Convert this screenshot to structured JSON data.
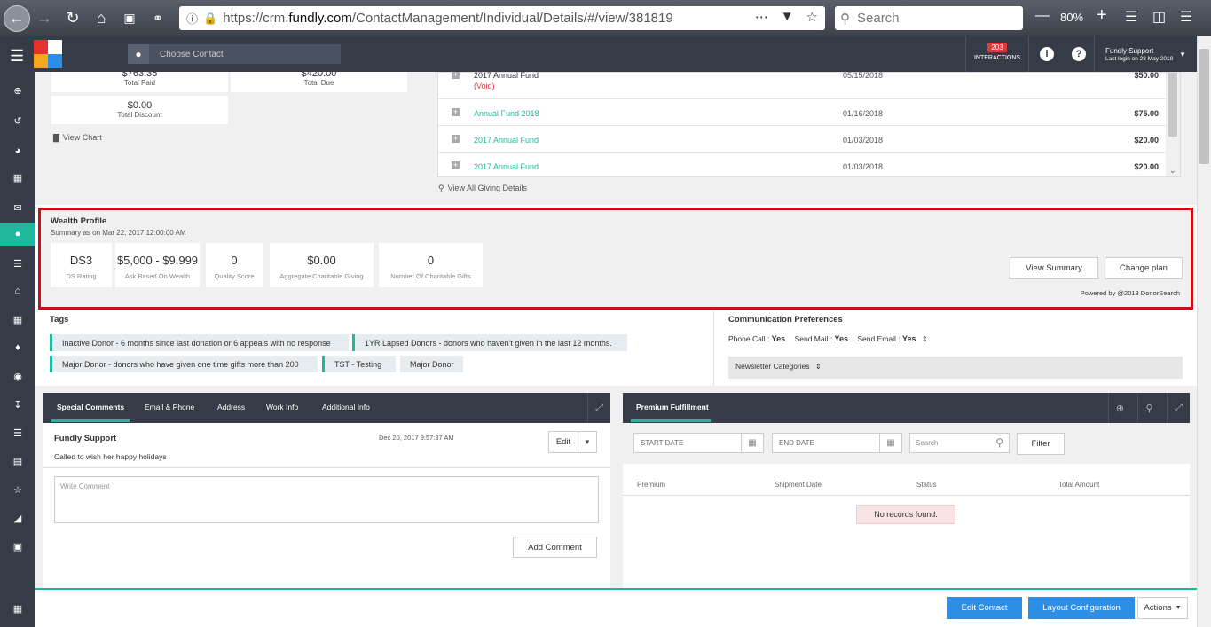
{
  "browser": {
    "url_prefix": "https://crm.",
    "url_domain": "fundly.com",
    "url_path": "/ContactManagement/Individual/Details/#/view/381819",
    "search_placeholder": "Search",
    "zoom": "80%"
  },
  "header": {
    "contact_placeholder": "Choose Contact",
    "interactions_count": "203",
    "interactions_label": "INTERACTIONS",
    "user_name": "Fundly Support",
    "last_login": "Last login on 28 May 2018"
  },
  "summary": {
    "total_paid_value": "$763.35",
    "total_paid_label": "Total Paid",
    "total_due_value": "$420.00",
    "total_due_label": "Total Due",
    "total_discount_value": "$0.00",
    "total_discount_label": "Total Discount",
    "view_chart": "View Chart"
  },
  "giving": {
    "rows": [
      {
        "fund": "2017 Annual Fund",
        "note": "(Void)",
        "date": "05/15/2018",
        "amount": "$50.00"
      },
      {
        "fund": "Annual Fund 2018",
        "date": "01/16/2018",
        "amount": "$75.00"
      },
      {
        "fund": "2017 Annual Fund",
        "date": "01/03/2018",
        "amount": "$20.00"
      },
      {
        "fund": "2017 Annual Fund",
        "date": "01/03/2018",
        "amount": "$20.00"
      }
    ],
    "view_all": "View All Giving Details"
  },
  "wealth": {
    "title": "Wealth Profile",
    "subtitle": "Summary as on Mar 22, 2017 12:00:00 AM",
    "cards": [
      {
        "value": "DS3",
        "label": "DS Rating"
      },
      {
        "value": "$5,000 - $9,999",
        "label": "Ask Based On Wealth"
      },
      {
        "value": "0",
        "label": "Quality Score"
      },
      {
        "value": "$0.00",
        "label": "Aggregate Charitable Giving"
      },
      {
        "value": "0",
        "label": "Number Of Charitable Gifts"
      }
    ],
    "view_summary": "View Summary",
    "change_plan": "Change plan",
    "powered_by": "Powered by @2018 DonorSearch"
  },
  "tags": {
    "title": "Tags",
    "items": [
      "Inactive Donor - 6 months since last donation or 6 appeals with no response",
      "1YR Lapsed Donors - donors who haven't given in the last 12 months.",
      "Major Donor - donors who have given one time gifts more than 200",
      "TST - Testing",
      "Major Donor"
    ]
  },
  "communication": {
    "title": "Communication Preferences",
    "phone_label": "Phone Call : ",
    "phone_value": "Yes",
    "mail_label": "Send Mail : ",
    "mail_value": "Yes",
    "email_label": "Send Email : ",
    "email_value": "Yes",
    "newsletter": "Newsletter Categories"
  },
  "comments": {
    "tabs": [
      "Special Comments",
      "Email & Phone",
      "Address",
      "Work Info",
      "Additional Info"
    ],
    "author": "Fundly Support",
    "date": "Dec 20, 2017 9:57:37 AM",
    "text": "Called to wish her happy holidays",
    "edit": "Edit",
    "placeholder": "Write Comment",
    "add_button": "Add Comment"
  },
  "premium": {
    "tab": "Premium Fulfillment",
    "start_date": "START DATE",
    "end_date": "END DATE",
    "search": "Search",
    "filter": "Filter",
    "columns": [
      "Premium",
      "Shipment Date",
      "Status",
      "Total Amount"
    ],
    "empty": "No records found."
  },
  "footer": {
    "edit_contact": "Edit Contact",
    "layout_config": "Layout Configuration",
    "actions": "Actions"
  },
  "colors": {
    "accent": "#1fb89f",
    "primary": "#2d8ee8",
    "header": "#353c48",
    "highlight": "#cc1010"
  }
}
